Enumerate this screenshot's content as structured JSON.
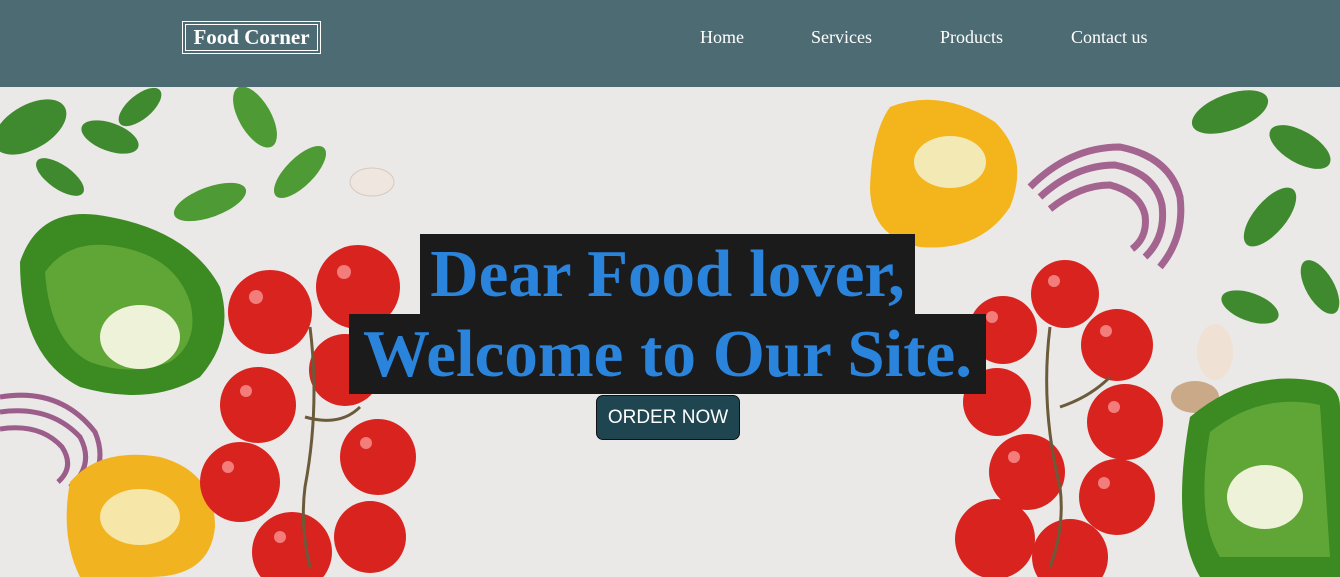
{
  "navbar": {
    "logo": "Food Corner",
    "links": [
      "Home",
      "Services",
      "Products",
      "Contact us"
    ]
  },
  "hero": {
    "headline_line1": "Dear Food lover,",
    "headline_line2": "Welcome to Our Site.",
    "cta_label": "ORDER NOW"
  },
  "colors": {
    "navbar_bg": "#4d6b73",
    "headline_text": "#2a84dc",
    "headline_bg": "#1b1b1b",
    "button_bg": "#1f4650"
  }
}
